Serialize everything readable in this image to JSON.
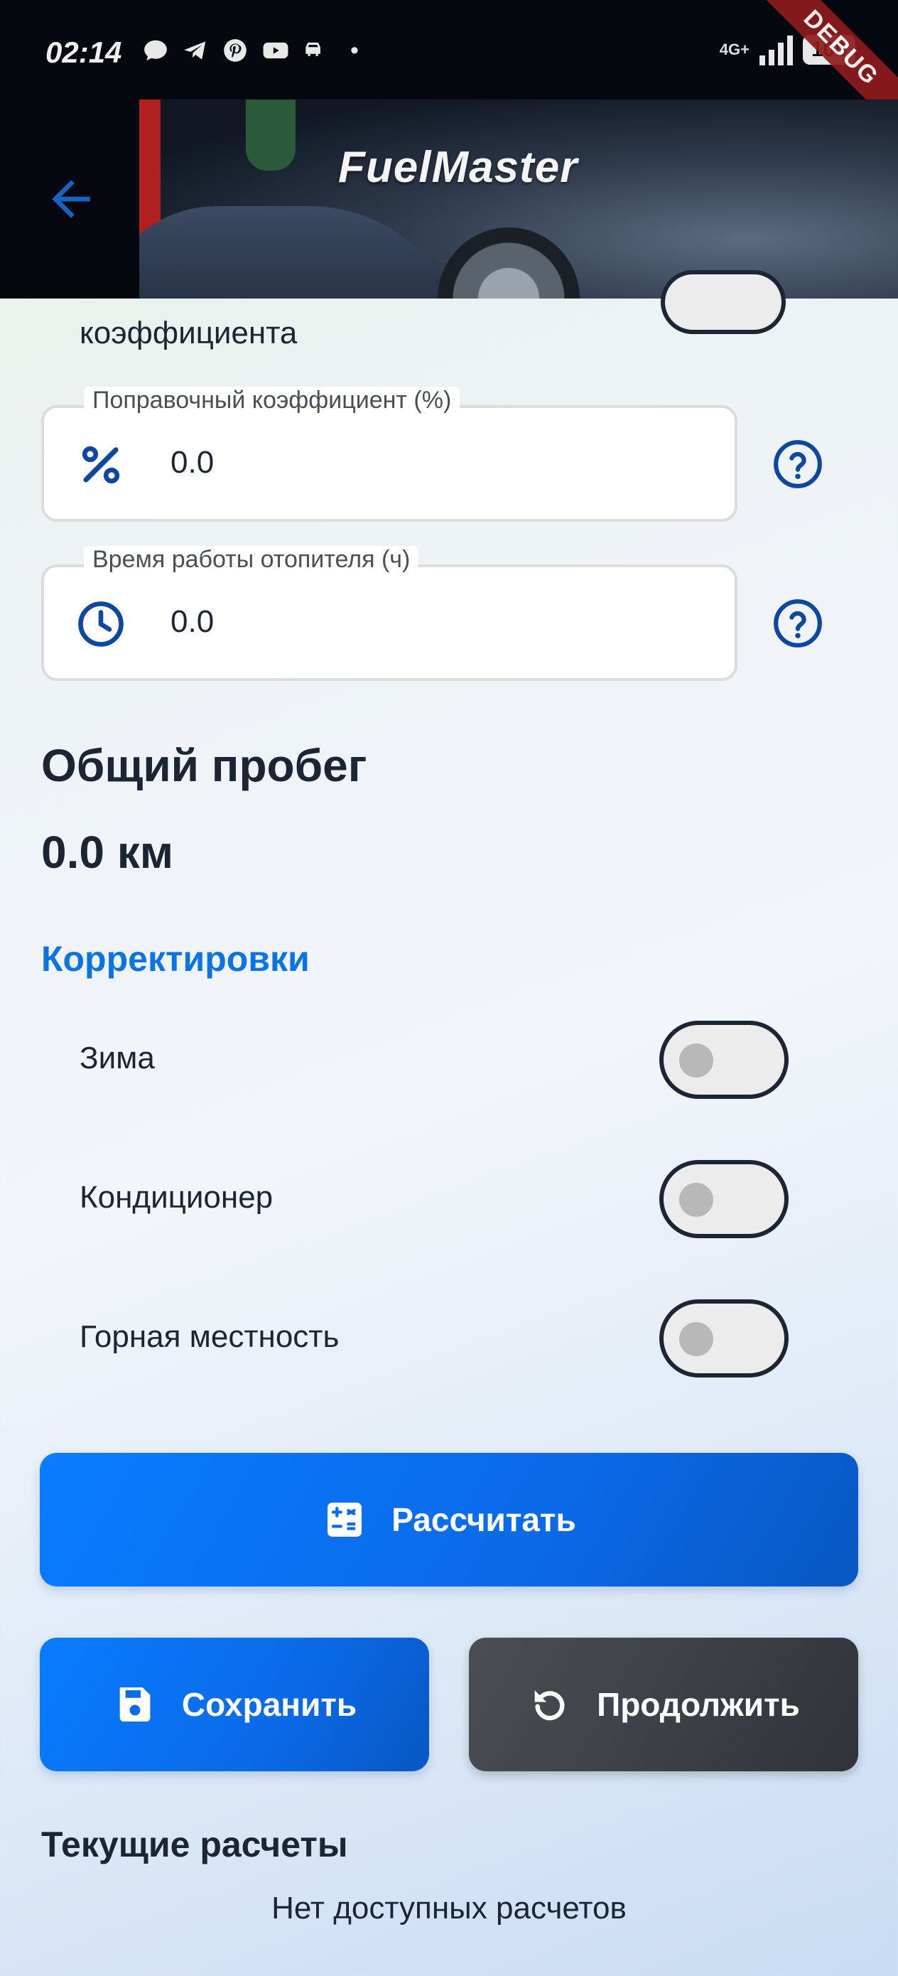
{
  "status_bar": {
    "time": "02:14",
    "network": "4G+",
    "battery": "100",
    "debug": "DEBUG"
  },
  "header": {
    "back_icon": "arrow-back-icon",
    "banner_title": "FuelMaster"
  },
  "form": {
    "partial_label": "коэффициента",
    "correction_field": {
      "label": "Поправочный коэффициент (%)",
      "value": "0.0",
      "icon": "percent-icon"
    },
    "heater_field": {
      "label": "Время работы отопителя (ч)",
      "value": "0.0",
      "icon": "clock-icon"
    }
  },
  "mileage": {
    "title": "Общий пробег",
    "value": "0.0 км"
  },
  "adjustments": {
    "title": "Корректировки",
    "items": [
      {
        "label": "Зима",
        "enabled": false
      },
      {
        "label": "Кондиционер",
        "enabled": false
      },
      {
        "label": "Горная местность",
        "enabled": false
      }
    ]
  },
  "actions": {
    "calculate": "Рассчитать",
    "save": "Сохранить",
    "continue": "Продолжить"
  },
  "current": {
    "title": "Текущие расчеты",
    "empty": "Нет доступных расчетов"
  },
  "colors": {
    "accent": "#0A74E6",
    "icon": "#0D47A1",
    "dark_button": "#3A3E44"
  }
}
